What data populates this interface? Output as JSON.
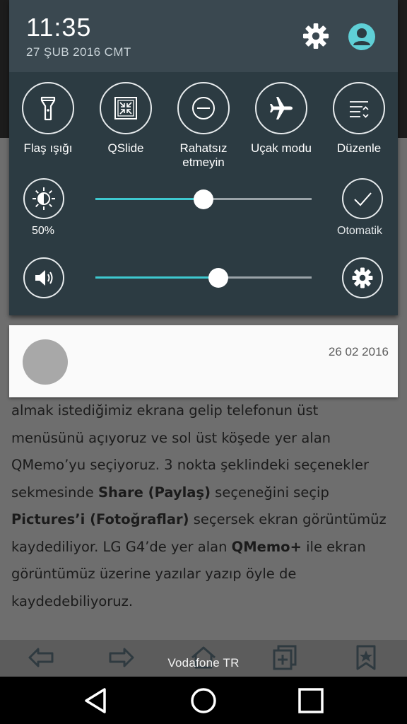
{
  "status": {
    "time": "11:35",
    "date": "27 ŞUB 2016 CMT",
    "settings_icon": "gear-icon",
    "user_icon": "person-icon",
    "avatar_color": "#5fcfd6"
  },
  "quick_settings": {
    "tiles": [
      {
        "label": "Flaş ışığı",
        "icon": "flashlight-icon"
      },
      {
        "label": "QSlide",
        "icon": "qslide-icon"
      },
      {
        "label": "Rahatsız etmeyin",
        "icon": "do-not-disturb-icon"
      },
      {
        "label": "Uçak modu",
        "icon": "airplane-icon"
      },
      {
        "label": "Düzenle",
        "icon": "edit-tiles-icon"
      }
    ],
    "brightness": {
      "label": "50%",
      "level": 0.5,
      "auto_label": "Otomatik"
    },
    "volume": {
      "level": 0.57
    },
    "accent_color": "#3ec8cf"
  },
  "notification": {
    "date": "26 02 2016"
  },
  "article": {
    "line1": "almak istediğimiz ekrana gelip telefonun üst",
    "line2": "menüsünü açıyoruz ve sol üst köşede yer alan",
    "line3": "QMemo’yu seçiyoruz. 3 nokta şeklindeki seçenekler",
    "line4_a": "sekmesinde ",
    "line4_b": "Share (Paylaş)",
    "line4_c": " seçeneğini seçip",
    "line5_a": "Pictures’i (Fotoğraflar)",
    "line5_b": " seçersek ekran görüntümüz",
    "line6_a": "kaydediliyor. LG G4’de yer alan ",
    "line6_b": "QMemo+",
    "line6_c": " ile ekran",
    "line7": "görüntümüz üzerine yazılar yazıp öyle de",
    "line8": "kaydedebiliyoruz."
  },
  "carrier": "Vodafone TR",
  "navigation": [
    "back-icon",
    "home-icon",
    "recents-icon"
  ]
}
